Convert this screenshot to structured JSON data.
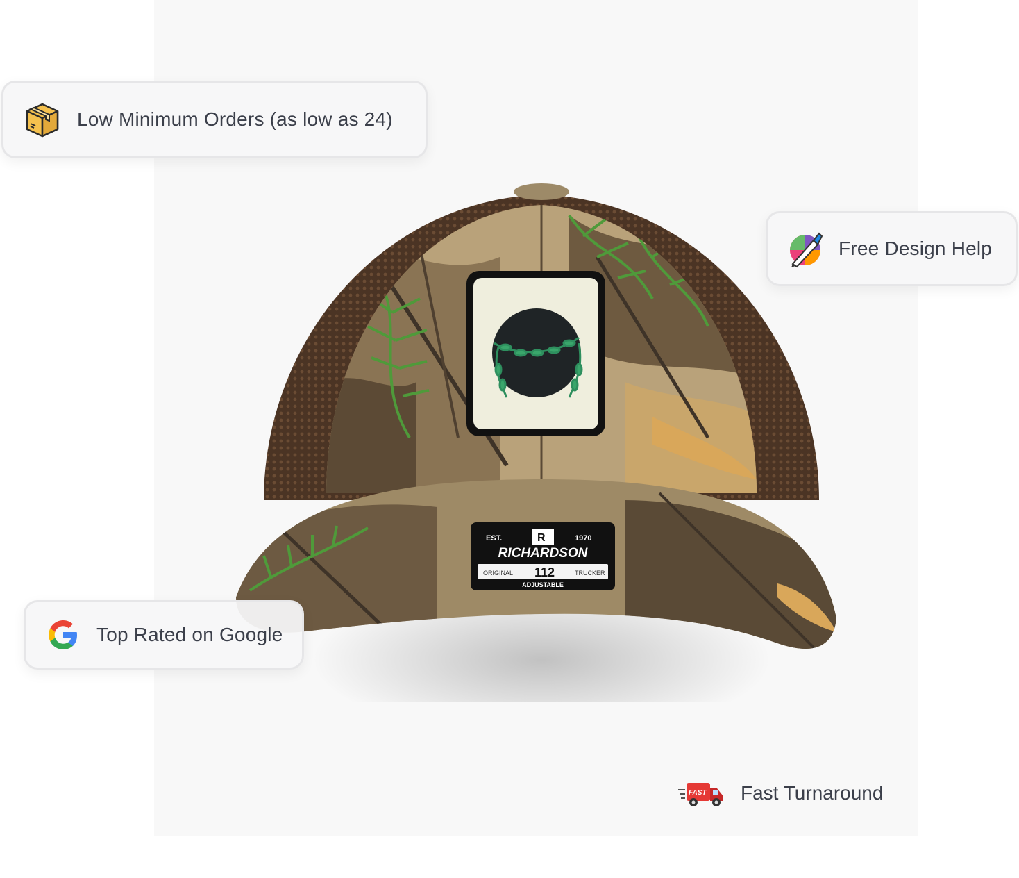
{
  "features": {
    "low_minimum": {
      "label": "Low Minimum Orders (as low as 24)",
      "icon": "package-box-icon"
    },
    "design_help": {
      "label": "Free Design Help",
      "icon": "design-pen-icon"
    },
    "google": {
      "label": "Top Rated on Google",
      "icon": "google-g-icon"
    },
    "turnaround": {
      "label": "Fast Turnaround",
      "icon": "fast-delivery-truck-icon",
      "truck_text": "FAST"
    }
  },
  "product": {
    "label_brand": "RICHARDSON",
    "label_est": "EST.",
    "label_year": "1970",
    "label_model": "112",
    "label_left": "ORIGINAL",
    "label_right": "TRUCKER",
    "label_bottom": "ADJUSTABLE"
  },
  "colors": {
    "text": "#3b3f4a",
    "backdrop": "#f8f8f8",
    "mesh_brown": "#5a3f2b",
    "camo_tan": "#b9a27a",
    "leaf_green": "#4f9a3a",
    "patch_cream": "#efeedd",
    "box_yellow": "#f5c14e",
    "truck_red": "#e53935"
  }
}
